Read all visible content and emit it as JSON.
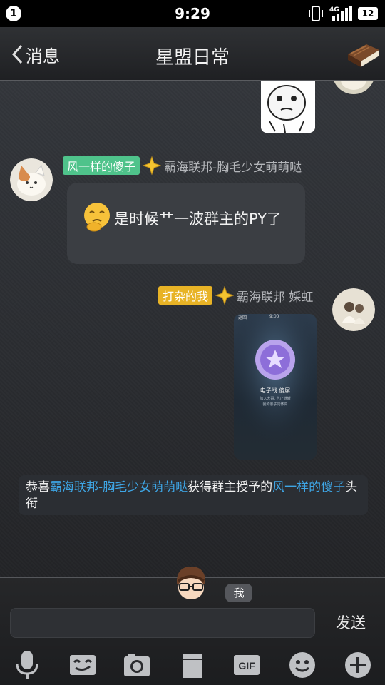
{
  "status_bar": {
    "notification_count": "1",
    "time": "9:29",
    "network": "4G",
    "battery": "12"
  },
  "nav": {
    "back_label": "消息",
    "title": "星盟日常"
  },
  "messages": {
    "incoming": {
      "sender_tag": "风一样的傻子",
      "sender_group": "霸海联邦-胸毛少女萌萌哒",
      "text": "是时候艹一波群主的PY了"
    },
    "outgoing": {
      "sender_tag": "打杂的我",
      "sender_group": "霸海联邦 婇虹",
      "screenshot": {
        "time": "9:00",
        "back": "返回",
        "title": "电子战 傻屌",
        "line1": "加入大哥, 艺正道耀",
        "line2": "我的亲子同体内"
      }
    },
    "system": {
      "prefix": "恭喜",
      "member": "霸海联邦-胸毛少女萌萌哒",
      "middle": "获得群主授予的",
      "title": "风一样的傻子",
      "suffix": "头衔"
    }
  },
  "input": {
    "me_label": "我",
    "value": "",
    "placeholder": "",
    "send_label": "发送"
  },
  "toolbar": {
    "gif_label": "GIF"
  },
  "colors": {
    "highlight": "#3ea6e6",
    "tag_green": "#4fc38b",
    "tag_yellow": "#e8b326"
  },
  "icons": [
    "microphone-icon",
    "emoticon-sticker-icon",
    "camera-icon",
    "paper-bag-icon",
    "gif-icon",
    "smiley-icon",
    "plus-icon",
    "book-icon"
  ]
}
